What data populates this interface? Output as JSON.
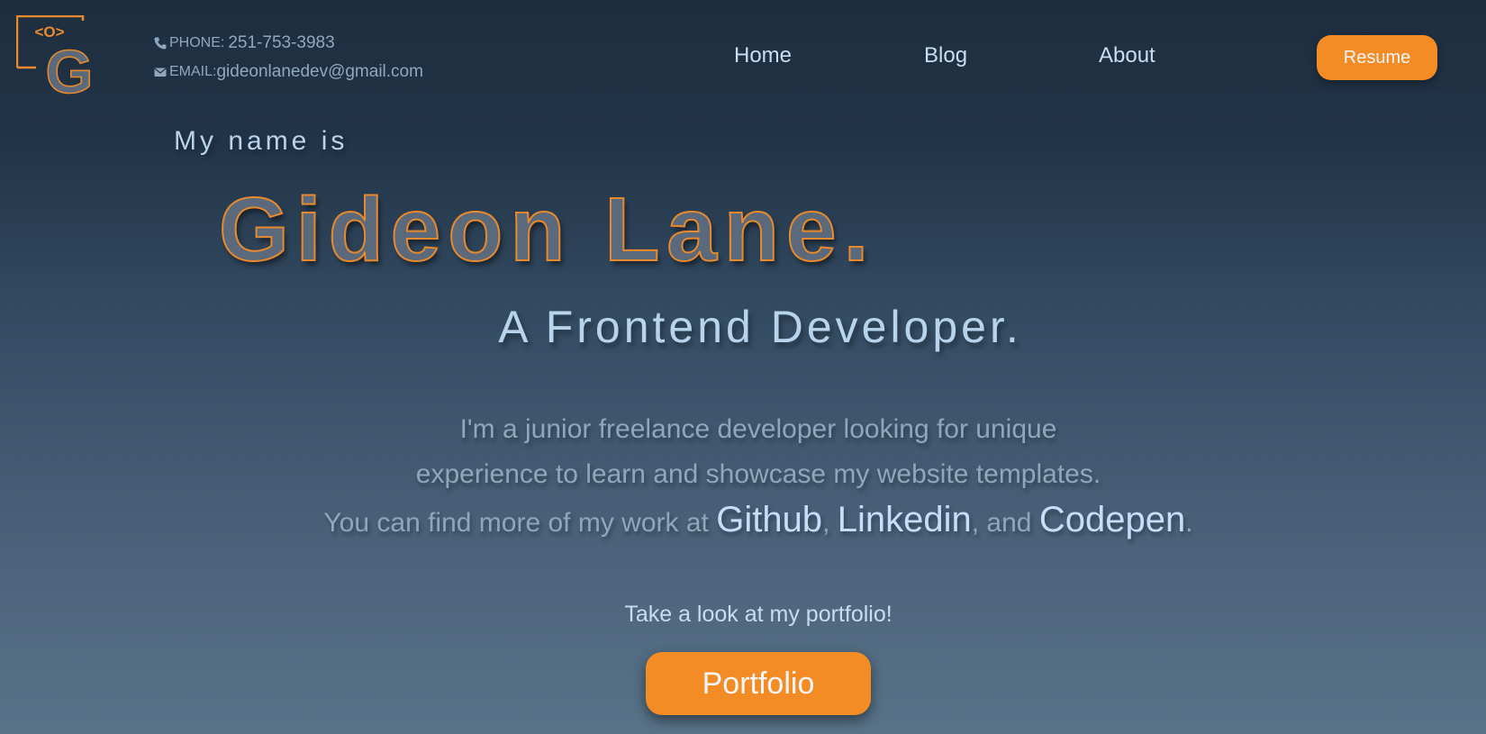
{
  "logo": {
    "icon": "code-g-logo",
    "bracket_text": "<O>",
    "letter": "G"
  },
  "contact": {
    "phone_label": "PHONE:",
    "phone_value": "251-753-3983",
    "email_label": "EMAIL:",
    "email_value": "gideonlanedev@gmail.com"
  },
  "nav": {
    "items": [
      {
        "label": "Home"
      },
      {
        "label": "Blog"
      },
      {
        "label": "About"
      }
    ],
    "resume_label": "Resume"
  },
  "hero": {
    "intro": "My name is",
    "name": "Gideon Lane.",
    "tagline": "A Frontend Developer.",
    "bio_line1": "I'm a junior freelance developer looking for unique",
    "bio_line2": "experience to learn and showcase my website templates.",
    "bio_line3_prefix": "You can find more of my work at",
    "link_github": "Github",
    "sep_comma": ",",
    "link_linkedin": "Linkedin",
    "sep_and": ", and",
    "link_codepen": "Codepen",
    "end_period": "."
  },
  "cta": {
    "text": "Take a look at my portfolio!",
    "button_label": "Portfolio"
  },
  "colors": {
    "accent": "#f48c25",
    "text_light": "#b8d4ec",
    "text_muted": "#8fa6bb",
    "bg_top": "#1e2e3f",
    "bg_bottom": "#587389"
  }
}
